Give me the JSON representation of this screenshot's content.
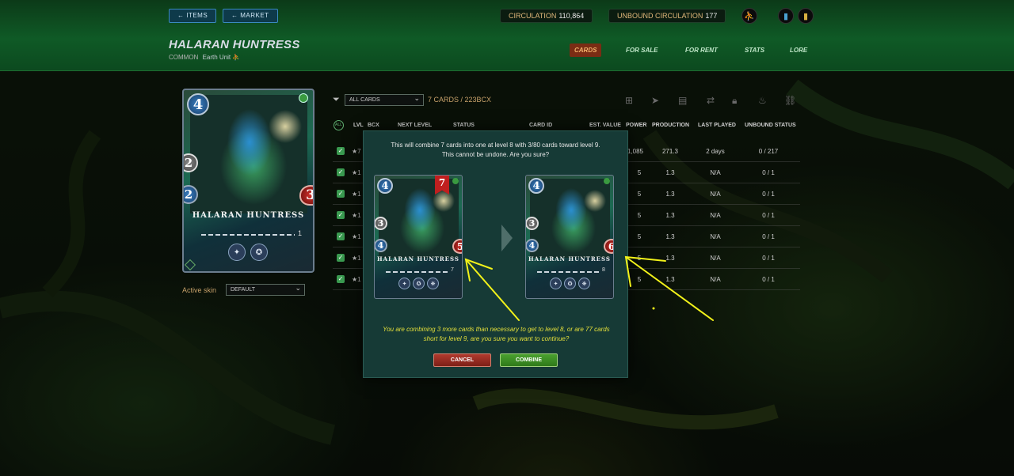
{
  "nav": {
    "items_label": "ITEMS",
    "market_label": "MARKET"
  },
  "stats": {
    "circulation_label": "CIRCULATION",
    "circulation_value": "110,864",
    "unbound_label": "UNBOUND CIRCULATION",
    "unbound_value": "177"
  },
  "card": {
    "name": "HALARAN HUNTRESS",
    "rarity": "COMMON",
    "element": "Earth",
    "type": "Unit",
    "mana": "4",
    "attack": "2",
    "speed": "2",
    "health": "3",
    "level": "1",
    "card_name_upper": "HALARAN HUNTRESS"
  },
  "tabs": [
    "CARDS",
    "FOR SALE",
    "FOR RENT",
    "STATS",
    "LORE"
  ],
  "skin": {
    "label": "Active skin",
    "value": "DEFAULT"
  },
  "filter": {
    "value": "ALL CARDS",
    "count": "7 CARDS / 223BCX"
  },
  "table": {
    "all_label": "ALL",
    "headers": [
      "LVL",
      "BCX",
      "NEXT LEVEL",
      "STATUS",
      "CARD ID",
      "EST. VALUE",
      "POWER",
      "PRODUCTION",
      "LAST PLAYED",
      "UNBOUND STATUS"
    ],
    "rows": [
      {
        "star": "★7",
        "value": "1,085",
        "production": "271.3",
        "last_played": "2 days",
        "unbound": "0 / 217"
      },
      {
        "star": "★1",
        "value": "5",
        "production": "1.3",
        "last_played": "N/A",
        "unbound": "0 / 1"
      },
      {
        "star": "★1",
        "value": "5",
        "production": "1.3",
        "last_played": "N/A",
        "unbound": "0 / 1"
      },
      {
        "star": "★1",
        "value": "5",
        "production": "1.3",
        "last_played": "N/A",
        "unbound": "0 / 1"
      },
      {
        "star": "★1",
        "value": "5",
        "production": "1.3",
        "last_played": "N/A",
        "unbound": "0 / 1"
      },
      {
        "star": "★1",
        "value": "5",
        "production": "1.3",
        "last_played": "N/A",
        "unbound": "0 / 1"
      },
      {
        "star": "★1",
        "value": "5",
        "production": "1.3",
        "last_played": "N/A",
        "unbound": "0 / 1"
      }
    ]
  },
  "modal": {
    "line1": "This will combine 7 cards into one at level 8 with 3/80 cards toward level 9.",
    "line2": "This cannot be undone. Are you sure?",
    "before": {
      "mana": "4",
      "attack": "3",
      "speed": "4",
      "health": "5",
      "level": "7",
      "qty": "7"
    },
    "after": {
      "mana": "4",
      "attack": "3",
      "speed": "4",
      "health": "6",
      "level": "8"
    },
    "warning": "You are combining 3 more cards than necessary to get to level 8, or are 77 cards short for level 9, are you sure you want to continue?",
    "cancel_label": "CANCEL",
    "combine_label": "COMBINE"
  },
  "colors": {
    "accent_gold": "#c6a06a",
    "warning": "#e4df3a",
    "header_green": "#0f5a26"
  }
}
